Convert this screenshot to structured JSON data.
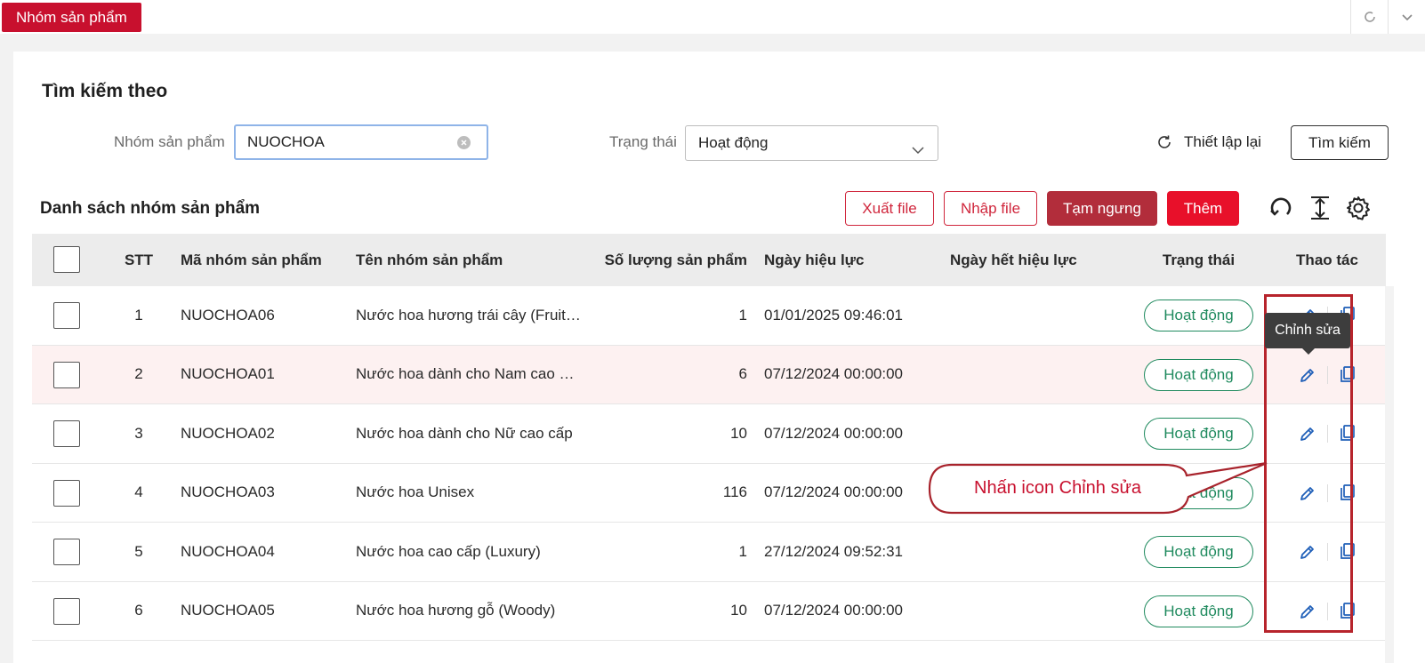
{
  "header": {
    "active_tab": "Nhóm sản phẩm",
    "refresh_icon": "refresh-icon",
    "expand_icon": "chevron-down-icon"
  },
  "search": {
    "title": "Tìm kiếm theo",
    "group_label": "Nhóm sản phẩm",
    "group_value": "NUOCHOA",
    "status_label": "Trạng thái",
    "status_value": "Hoạt động",
    "reset_label": "Thiết lập lại",
    "search_label": "Tìm kiếm"
  },
  "list": {
    "title": "Danh sách nhóm sản phẩm",
    "export_label": "Xuất file",
    "import_label": "Nhập file",
    "suspend_label": "Tạm ngưng",
    "add_label": "Thêm"
  },
  "table": {
    "headers": {
      "stt": "STT",
      "code": "Mã nhóm sản phẩm",
      "name": "Tên nhóm sản phẩm",
      "qty": "Số lượng sản phẩm",
      "start": "Ngày hiệu lực",
      "end": "Ngày hết hiệu lực",
      "status": "Trạng thái",
      "actions": "Thao tác"
    },
    "rows": [
      {
        "stt": "1",
        "code": "NUOCHOA06",
        "name": "Nước hoa hương trái cây (Fruit…",
        "qty": "1",
        "start": "01/01/2025 09:46:01",
        "end": "",
        "status": "Hoạt động"
      },
      {
        "stt": "2",
        "code": "NUOCHOA01",
        "name": "Nước hoa dành cho Nam cao …",
        "qty": "6",
        "start": "07/12/2024 00:00:00",
        "end": "",
        "status": "Hoạt động"
      },
      {
        "stt": "3",
        "code": "NUOCHOA02",
        "name": "Nước hoa dành cho Nữ cao cấp",
        "qty": "10",
        "start": "07/12/2024 00:00:00",
        "end": "",
        "status": "Hoạt động"
      },
      {
        "stt": "4",
        "code": "NUOCHOA03",
        "name": "Nước hoa Unisex",
        "qty": "116",
        "start": "07/12/2024 00:00:00",
        "end": "",
        "status": "Hoạt động"
      },
      {
        "stt": "5",
        "code": "NUOCHOA04",
        "name": "Nước hoa cao cấp (Luxury)",
        "qty": "1",
        "start": "27/12/2024 09:52:31",
        "end": "",
        "status": "Hoạt động"
      },
      {
        "stt": "6",
        "code": "NUOCHOA05",
        "name": "Nước hoa hương gỗ (Woody)",
        "qty": "10",
        "start": "07/12/2024 00:00:00",
        "end": "",
        "status": "Hoạt động"
      }
    ]
  },
  "tooltip": "Chỉnh sửa",
  "callout": "Nhấn icon Chỉnh sửa",
  "colors": {
    "brand": "#c8102e",
    "status_green": "#1f8a5e",
    "action_blue": "#1f5fb8",
    "annotation": "#b7242c"
  }
}
